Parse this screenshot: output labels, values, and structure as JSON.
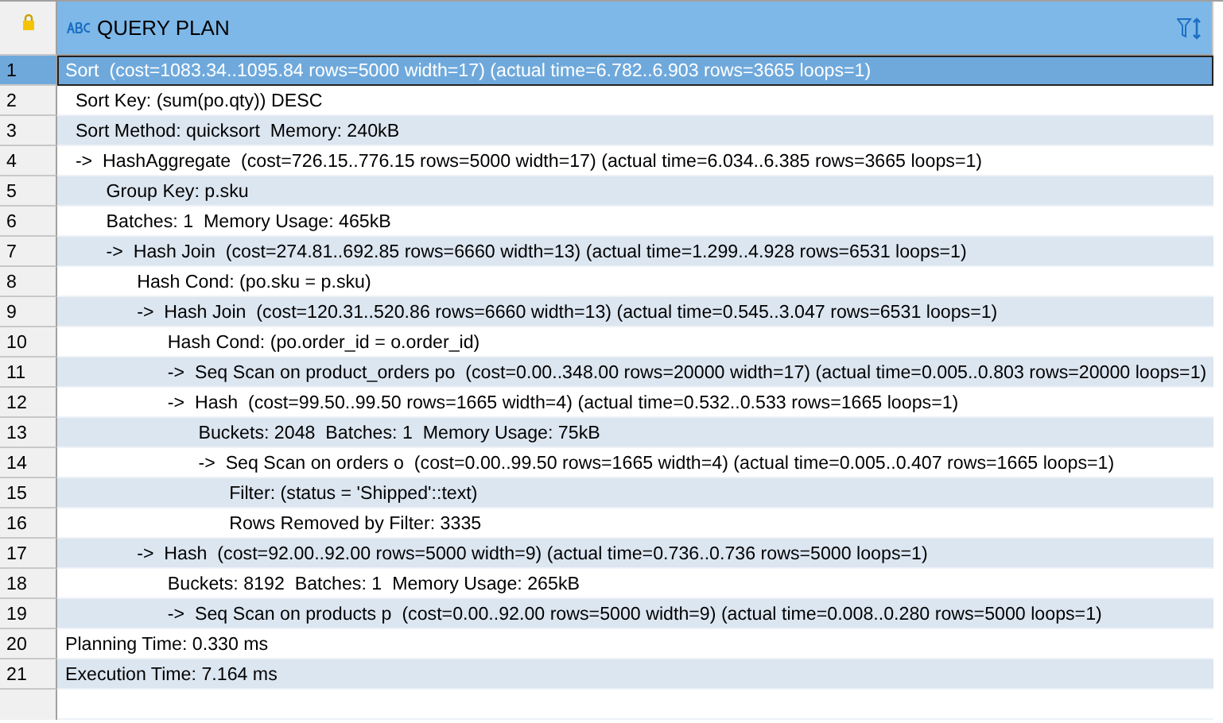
{
  "grid": {
    "column": {
      "title": "QUERY PLAN"
    },
    "rows": [
      {
        "number": "1",
        "text": "Sort  (cost=1083.34..1095.84 rows=5000 width=17) (actual time=6.782..6.903 rows=3665 loops=1)",
        "selected": true
      },
      {
        "number": "2",
        "text": "  Sort Key: (sum(po.qty)) DESC",
        "selected": false
      },
      {
        "number": "3",
        "text": "  Sort Method: quicksort  Memory: 240kB",
        "selected": false
      },
      {
        "number": "4",
        "text": "  ->  HashAggregate  (cost=726.15..776.15 rows=5000 width=17) (actual time=6.034..6.385 rows=3665 loops=1)",
        "selected": false
      },
      {
        "number": "5",
        "text": "        Group Key: p.sku",
        "selected": false
      },
      {
        "number": "6",
        "text": "        Batches: 1  Memory Usage: 465kB",
        "selected": false
      },
      {
        "number": "7",
        "text": "        ->  Hash Join  (cost=274.81..692.85 rows=6660 width=13) (actual time=1.299..4.928 rows=6531 loops=1)",
        "selected": false
      },
      {
        "number": "8",
        "text": "              Hash Cond: (po.sku = p.sku)",
        "selected": false
      },
      {
        "number": "9",
        "text": "              ->  Hash Join  (cost=120.31..520.86 rows=6660 width=13) (actual time=0.545..3.047 rows=6531 loops=1)",
        "selected": false
      },
      {
        "number": "10",
        "text": "                    Hash Cond: (po.order_id = o.order_id)",
        "selected": false
      },
      {
        "number": "11",
        "text": "                    ->  Seq Scan on product_orders po  (cost=0.00..348.00 rows=20000 width=17) (actual time=0.005..0.803 rows=20000 loops=1)",
        "selected": false
      },
      {
        "number": "12",
        "text": "                    ->  Hash  (cost=99.50..99.50 rows=1665 width=4) (actual time=0.532..0.533 rows=1665 loops=1)",
        "selected": false
      },
      {
        "number": "13",
        "text": "                          Buckets: 2048  Batches: 1  Memory Usage: 75kB",
        "selected": false
      },
      {
        "number": "14",
        "text": "                          ->  Seq Scan on orders o  (cost=0.00..99.50 rows=1665 width=4) (actual time=0.005..0.407 rows=1665 loops=1)",
        "selected": false
      },
      {
        "number": "15",
        "text": "                                Filter: (status = 'Shipped'::text)",
        "selected": false
      },
      {
        "number": "16",
        "text": "                                Rows Removed by Filter: 3335",
        "selected": false
      },
      {
        "number": "17",
        "text": "              ->  Hash  (cost=92.00..92.00 rows=5000 width=9) (actual time=0.736..0.736 rows=5000 loops=1)",
        "selected": false
      },
      {
        "number": "18",
        "text": "                    Buckets: 8192  Batches: 1  Memory Usage: 265kB",
        "selected": false
      },
      {
        "number": "19",
        "text": "                    ->  Seq Scan on products p  (cost=0.00..92.00 rows=5000 width=9) (actual time=0.008..0.280 rows=5000 loops=1)",
        "selected": false
      },
      {
        "number": "20",
        "text": "Planning Time: 0.330 ms",
        "selected": false
      },
      {
        "number": "21",
        "text": "Execution Time: 7.164 ms",
        "selected": false
      }
    ]
  }
}
